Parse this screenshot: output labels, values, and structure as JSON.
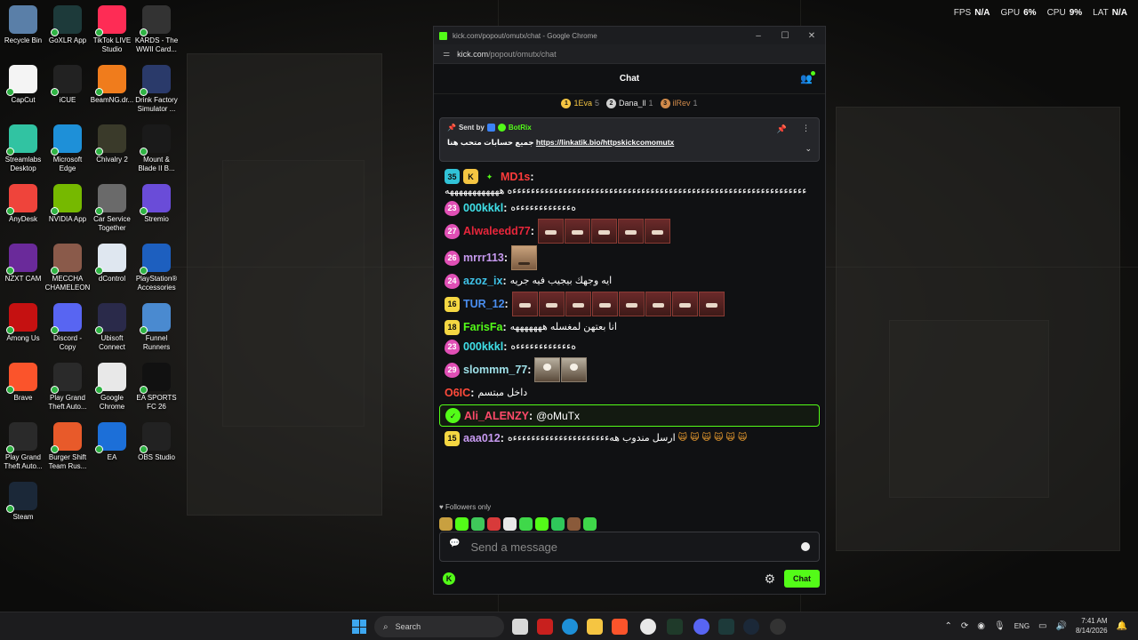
{
  "overlay": {
    "fps_label": "FPS",
    "fps_value": "N/A",
    "gpu_label": "GPU",
    "gpu_value": "6%",
    "cpu_label": "CPU",
    "cpu_value": "9%",
    "lat_label": "LAT",
    "lat_value": "N/A"
  },
  "desktop": {
    "icons": [
      {
        "label": "Recycle Bin",
        "icon": "recycle-bin-icon",
        "color": "#5a7fa8"
      },
      {
        "label": "GoXLR App",
        "icon": "goxlr-icon",
        "color": "#1d3a3a"
      },
      {
        "label": "TikTok LIVE Studio",
        "icon": "tiktok-icon",
        "color": "#fe2c55"
      },
      {
        "label": "KARDS - The WWII Card...",
        "icon": "kards-icon",
        "color": "#333333"
      },
      {
        "label": "CapCut",
        "icon": "capcut-icon",
        "color": "#f4f4f4"
      },
      {
        "label": "iCUE",
        "icon": "icue-icon",
        "color": "#222222"
      },
      {
        "label": "BeamNG.dr...",
        "icon": "beamng-icon",
        "color": "#f07c1c"
      },
      {
        "label": "Drink Factory Simulator ...",
        "icon": "drink-factory-icon",
        "color": "#2a3a6a"
      },
      {
        "label": "Streamlabs Desktop",
        "icon": "streamlabs-icon",
        "color": "#31c3a2"
      },
      {
        "label": "Microsoft Edge",
        "icon": "edge-icon",
        "color": "#1e90d8"
      },
      {
        "label": "Chivalry 2",
        "icon": "chivalry-icon",
        "color": "#3a3a2a"
      },
      {
        "label": "Mount & Blade II B...",
        "icon": "bannerlord-icon",
        "color": "#1a1a1a"
      },
      {
        "label": "AnyDesk",
        "icon": "anydesk-icon",
        "color": "#ef443b"
      },
      {
        "label": "NVIDIA App",
        "icon": "nvidia-icon",
        "color": "#76b900"
      },
      {
        "label": "Car Service Together",
        "icon": "car-service-icon",
        "color": "#6a6a6a"
      },
      {
        "label": "Stremio",
        "icon": "stremio-icon",
        "color": "#6a4cd8"
      },
      {
        "label": "NZXT CAM",
        "icon": "nzxt-icon",
        "color": "#6a2a9a"
      },
      {
        "label": "MECCHA CHAMELEON",
        "icon": "meccha-icon",
        "color": "#8a5a4a"
      },
      {
        "label": "dControl",
        "icon": "dcontrol-icon",
        "color": "#dfe7f0"
      },
      {
        "label": "PlayStation® Accessories",
        "icon": "playstation-icon",
        "color": "#1d5fbf"
      },
      {
        "label": "Among Us",
        "icon": "among-us-icon",
        "color": "#c51111"
      },
      {
        "label": "Discord - Copy",
        "icon": "discord-icon",
        "color": "#5865f2"
      },
      {
        "label": "Ubisoft Connect",
        "icon": "ubisoft-icon",
        "color": "#2a2a4a"
      },
      {
        "label": "Funnel Runners",
        "icon": "funnel-runners-icon",
        "color": "#4a8ad0"
      },
      {
        "label": "Brave",
        "icon": "brave-icon",
        "color": "#fb542b"
      },
      {
        "label": "Play Grand Theft Auto...",
        "icon": "gta-icon",
        "color": "#2a2a2a"
      },
      {
        "label": "Google Chrome",
        "icon": "chrome-icon",
        "color": "#e8e8e8"
      },
      {
        "label": "EA SPORTS FC 26",
        "icon": "eafc-icon",
        "color": "#111111"
      },
      {
        "label": "Play Grand Theft Auto...",
        "icon": "gta-icon",
        "color": "#2a2a2a"
      },
      {
        "label": "Burger Shift Team Rus...",
        "icon": "burger-shift-icon",
        "color": "#e85a2a"
      },
      {
        "label": "EA",
        "icon": "ea-icon",
        "color": "#1c6fd8"
      },
      {
        "label": "OBS Studio",
        "icon": "obs-icon",
        "color": "#222222"
      },
      {
        "label": "Steam",
        "icon": "steam-icon",
        "color": "#1b2838"
      }
    ]
  },
  "window": {
    "title": "kick.com/popout/omutx/chat - Google Chrome",
    "url_host": "kick.com",
    "url_path": "/popout/omutx/chat"
  },
  "chat": {
    "header": "Chat",
    "leaders": [
      {
        "rank": "1",
        "name": "1Eva",
        "count": "5",
        "color": "#f5c542"
      },
      {
        "rank": "2",
        "name": "Dana_ll",
        "count": "1",
        "color": "#d0d0d0"
      },
      {
        "rank": "3",
        "name": "ilRev",
        "count": "1",
        "color": "#d08a4a"
      }
    ],
    "pinned": {
      "sent_by": "Sent by",
      "bot": "BotRix",
      "text_ar": "جميع حسابات متحب هنا",
      "link": "https://linkatik.bio/httpskickcomomutx"
    },
    "messages": [
      {
        "badge": "35",
        "badge_color": "#31c3d8",
        "user": "MD1s",
        "user_color": "#ff3b3b",
        "text": "ءءءءءءءءءءءءءءءءءءءءءءءءءءءءءءءءءءءءءءءءءءءءءءءءءءءءءءءءءءءءءءءءه ههههههههههههه"
      },
      {
        "badge": "23",
        "badge_color": "#e04fb5",
        "user": "000kkkl",
        "user_color": "#3fe0e8",
        "text": "هءءءءءءءءءءءءه"
      },
      {
        "badge": "27",
        "badge_color": "#e04fb5",
        "user": "Alwaleedd77",
        "user_color": "#e8263b",
        "text": ""
      },
      {
        "badge": "26",
        "badge_color": "#e04fb5",
        "user": "mrrr113",
        "user_color": "#c79af0",
        "text": ""
      },
      {
        "badge": "24",
        "badge_color": "#e04fb5",
        "user": "azoz_ix",
        "user_color": "#3fc3e8",
        "text": "ايه وجهك بيجيب فيه جريه"
      },
      {
        "badge": "16",
        "badge_color": "#f5d742",
        "user": "TUR_12",
        "user_color": "#4a8ef0",
        "text": ""
      },
      {
        "badge": "18",
        "badge_color": "#f5d742",
        "user": "FarisFa",
        "user_color": "#53fc18",
        "text": "انا بعتهن لمغسله هههههههه"
      },
      {
        "badge": "23",
        "badge_color": "#e04fb5",
        "user": "000kkkl",
        "user_color": "#3fe0e8",
        "text": "هءءءءءءءءءءءءه"
      },
      {
        "badge": "29",
        "badge_color": "#e04fb5",
        "user": "slommm_77",
        "user_color": "#9ee0e8",
        "text": ""
      },
      {
        "badge": "",
        "badge_color": "",
        "user": "O6IC",
        "user_color": "#ff4a3b",
        "text": "داخل مبتسم"
      },
      {
        "badge": "",
        "badge_color": "",
        "user": "Ali_ALENZY",
        "user_color": "#ff4a6a",
        "text": "@oMuTx"
      },
      {
        "badge": "15",
        "badge_color": "#f5d742",
        "user": "aaa012",
        "user_color": "#c79af0",
        "text": "ارسل مندوب ههءءءءءءءءءءءءءءءءءءءءءه"
      }
    ],
    "followers_only": "Followers only",
    "input_placeholder": "Send a message",
    "chat_button": "Chat"
  },
  "taskbar": {
    "search_label": "Search",
    "lang": "ENG",
    "time": "7:41 AM",
    "date": "8/14/2026"
  }
}
